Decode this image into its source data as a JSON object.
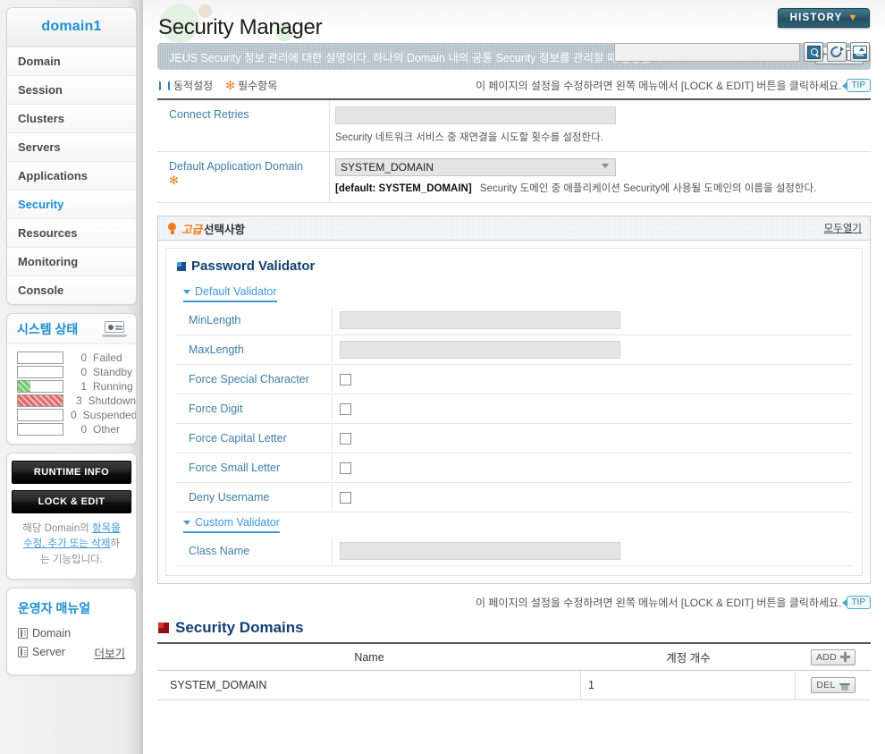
{
  "sidebar": {
    "domain_title": "domain1",
    "nav": [
      {
        "label": "Domain",
        "active": false
      },
      {
        "label": "Session",
        "active": false
      },
      {
        "label": "Clusters",
        "active": false
      },
      {
        "label": "Servers",
        "active": false
      },
      {
        "label": "Applications",
        "active": false
      },
      {
        "label": "Security",
        "active": true
      },
      {
        "label": "Resources",
        "active": false
      },
      {
        "label": "Monitoring",
        "active": false
      },
      {
        "label": "Console",
        "active": false
      }
    ],
    "system_status": {
      "title": "시스템 상태",
      "rows": [
        {
          "count": "0",
          "label": "Failed",
          "fill_pct": 0,
          "color": "none"
        },
        {
          "count": "0",
          "label": "Standby",
          "fill_pct": 0,
          "color": "none"
        },
        {
          "count": "1",
          "label": "Running",
          "fill_pct": 27,
          "color": "green"
        },
        {
          "count": "3",
          "label": "Shutdown",
          "fill_pct": 100,
          "color": "red"
        },
        {
          "count": "0",
          "label": "Suspended",
          "fill_pct": 0,
          "color": "none"
        },
        {
          "count": "0",
          "label": "Other",
          "fill_pct": 0,
          "color": "none"
        }
      ]
    },
    "runtime_info_label": "RUNTIME INFO",
    "lock_edit_label": "LOCK & EDIT",
    "lock_note_pre": "해당 Domain의 ",
    "lock_note_link": "항목을 수정, 추가 또는 삭제",
    "lock_note_post": "하는 기능입니다.",
    "manual": {
      "title": "운영자 매뉴얼",
      "items": [
        "Domain",
        "Server"
      ],
      "more_label": "더보기"
    }
  },
  "header": {
    "page_title": "Security Manager",
    "history_label": "HISTORY",
    "search_value": "",
    "search_placeholder": "",
    "description": "JEUS Security 정보 관리에 대한 설명이다. 하나의 Domain 내의 공통 Security 정보를 관리할 때 설정한다.",
    "help_label": "Help"
  },
  "legend": {
    "dynamic_label": "동적설정",
    "required_label": "필수항목",
    "tip_text": "이 페이지의 설정을 수정하려면 왼쪽 메뉴에서 [LOCK & EDIT] 버튼을 클릭하세요.",
    "tip_badge": "TIP"
  },
  "form": {
    "connect_retries": {
      "label": "Connect Retries",
      "value": "",
      "hint": "Security 네트워크 서비스 중 재연결을 시도할 횟수를 설정한다."
    },
    "default_application_domain": {
      "label": "Default Application Domain",
      "selected": "SYSTEM_DOMAIN",
      "options": [
        "SYSTEM_DOMAIN"
      ],
      "default_tag": "[default: SYSTEM_DOMAIN]",
      "hint": "Security 도메인 중 애플리케이션 Security에 사용될 도메인의 이름을 설정한다."
    }
  },
  "advanced": {
    "badge": "고급",
    "title": "선택사항",
    "expand_all": "모두열기",
    "password_validator_title": "Password Validator",
    "default_validator_label": "Default Validator",
    "default_rows": [
      {
        "label": "MinLength",
        "type": "text",
        "value": "",
        "checked": false
      },
      {
        "label": "MaxLength",
        "type": "text",
        "value": "",
        "checked": false
      },
      {
        "label": "Force Special Character",
        "type": "checkbox",
        "value": "",
        "checked": false
      },
      {
        "label": "Force Digit",
        "type": "checkbox",
        "value": "",
        "checked": false
      },
      {
        "label": "Force Capital Letter",
        "type": "checkbox",
        "value": "",
        "checked": false
      },
      {
        "label": "Force Small Letter",
        "type": "checkbox",
        "value": "",
        "checked": false
      },
      {
        "label": "Deny Username",
        "type": "checkbox",
        "value": "",
        "checked": false
      }
    ],
    "custom_validator_label": "Custom Validator",
    "custom_rows": [
      {
        "label": "Class Name",
        "type": "text",
        "value": "",
        "checked": false
      }
    ]
  },
  "security_domains": {
    "tip_text": "이 페이지의 설정을 수정하려면 왼쪽 메뉴에서 [LOCK & EDIT] 버튼을 클릭하세요.",
    "tip_badge": "TIP",
    "title": "Security Domains",
    "columns": [
      "Name",
      "계정 개수"
    ],
    "add_label": "ADD",
    "del_label": "DEL",
    "rows": [
      {
        "name": "SYSTEM_DOMAIN",
        "count": "1"
      }
    ]
  },
  "colors": {
    "accent_blue": "#1a8fd1",
    "label_blue": "#3e7fa8",
    "title_navy": "#123f72",
    "orange": "#f07c22",
    "running_green": "#74c96f",
    "shutdown_red": "#e06a6a",
    "history_teal": "#2e5c70"
  }
}
